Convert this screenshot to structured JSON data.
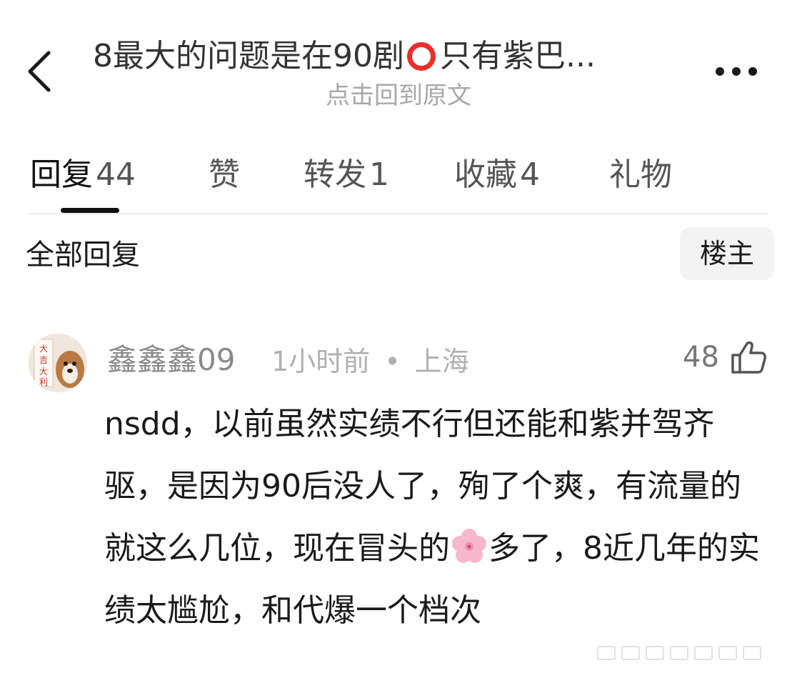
{
  "header": {
    "title_before": "8最大的问题是在90剧",
    "title_after": "只有紫巴...",
    "subtitle": "点击回到原文"
  },
  "tabs": [
    {
      "label": "回复",
      "count": "44"
    },
    {
      "label": "赞",
      "count": ""
    },
    {
      "label": "转发",
      "count": "1"
    },
    {
      "label": "收藏",
      "count": "4"
    },
    {
      "label": "礼物",
      "count": ""
    }
  ],
  "filter": {
    "all_replies": "全部回复",
    "op_only": "楼主"
  },
  "comment": {
    "username": "鑫鑫鑫09",
    "time": "1小时前",
    "separator": "•",
    "location": "上海",
    "likes": "48",
    "text_before_emoji": "nsdd，以前虽然实绩不行但还能和紫并驾齐驱，是因为90后没人了，殉了个爽，有流量的就这么几位，现在冒头的",
    "text_after_emoji": "多了，8近几年的实绩太尴尬，和代爆一个档次",
    "avatar_text": "大吉大利"
  },
  "icons": {
    "back": "chevron-left-icon",
    "more": "more-dots-icon",
    "like": "thumbs-up-icon",
    "circle_emoji": "red-circle-emoji",
    "flower_emoji": "cherry-blossom-emoji"
  },
  "colors": {
    "accent_red": "#e8302a",
    "text_primary": "#1a1a1a",
    "text_secondary": "#8a8a8a",
    "flower_pink": "#f7b7cc"
  }
}
